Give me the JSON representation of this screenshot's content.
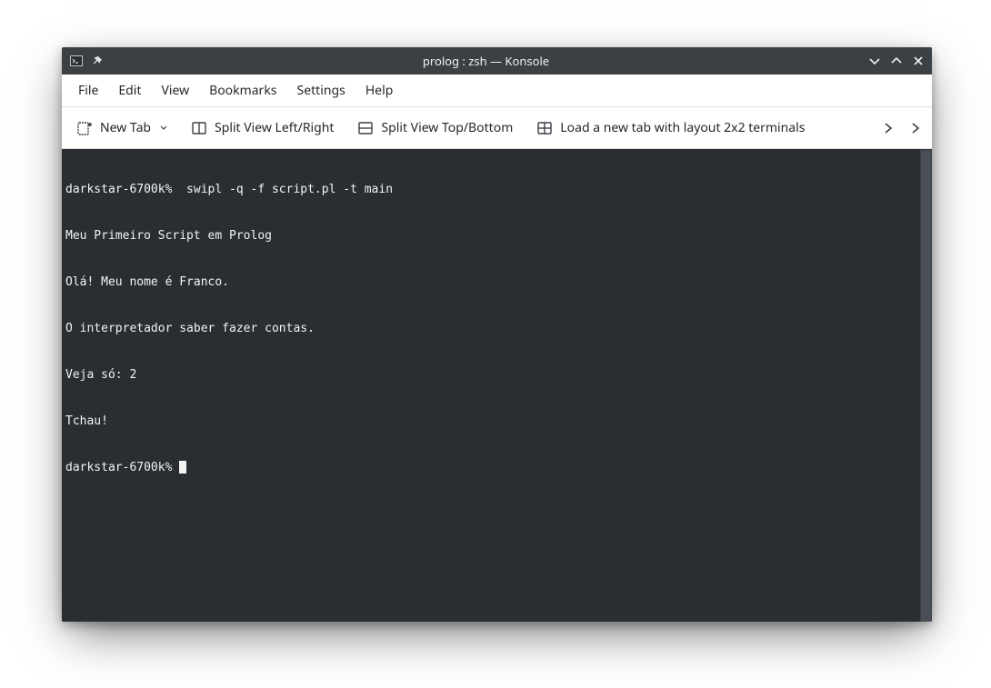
{
  "titlebar": {
    "title": "prolog : zsh — Konsole"
  },
  "menu": {
    "items": [
      "File",
      "Edit",
      "View",
      "Bookmarks",
      "Settings",
      "Help"
    ]
  },
  "toolbar": {
    "new_tab": "New Tab",
    "split_lr": "Split View Left/Right",
    "split_tb": "Split View Top/Bottom",
    "load_layout": "Load a new tab with layout 2x2 terminals"
  },
  "terminal": {
    "lines": [
      "darkstar-6700k%  swipl -q -f script.pl -t main",
      "Meu Primeiro Script em Prolog",
      "Olá! Meu nome é Franco.",
      "O interpretador saber fazer contas.",
      "Veja só: 2",
      "Tchau!"
    ],
    "prompt": "darkstar-6700k% "
  }
}
